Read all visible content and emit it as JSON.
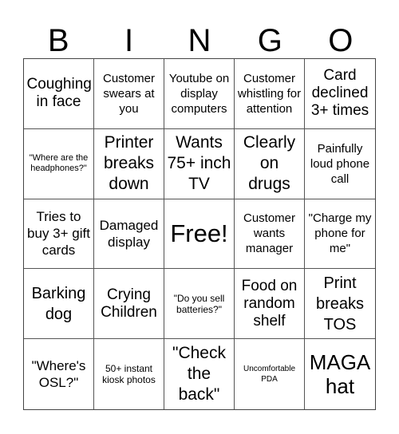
{
  "header": {
    "letters": [
      "B",
      "I",
      "N",
      "G",
      "O"
    ]
  },
  "cells": [
    "Coughing in face",
    "Customer swears at you",
    "Youtube on display computers",
    "Customer whistling for attention",
    "Card declined 3+ times",
    "\"Where are the headphones?\"",
    "Printer breaks down",
    "Wants 75+ inch TV",
    "Clearly on drugs",
    "Painfully loud phone call",
    "Tries to buy 3+ gift cards",
    "Damaged display",
    "Free!",
    "Customer wants manager",
    "\"Charge my phone for me\"",
    "Barking dog",
    "Crying Children",
    "\"Do you sell batteries?\"",
    "Food on random shelf",
    "Print breaks TOS",
    "\"Where's OSL?\"",
    "50+ instant kiosk photos",
    "\"Check the back\"",
    "Uncomfortable PDA",
    "MAGA hat"
  ]
}
